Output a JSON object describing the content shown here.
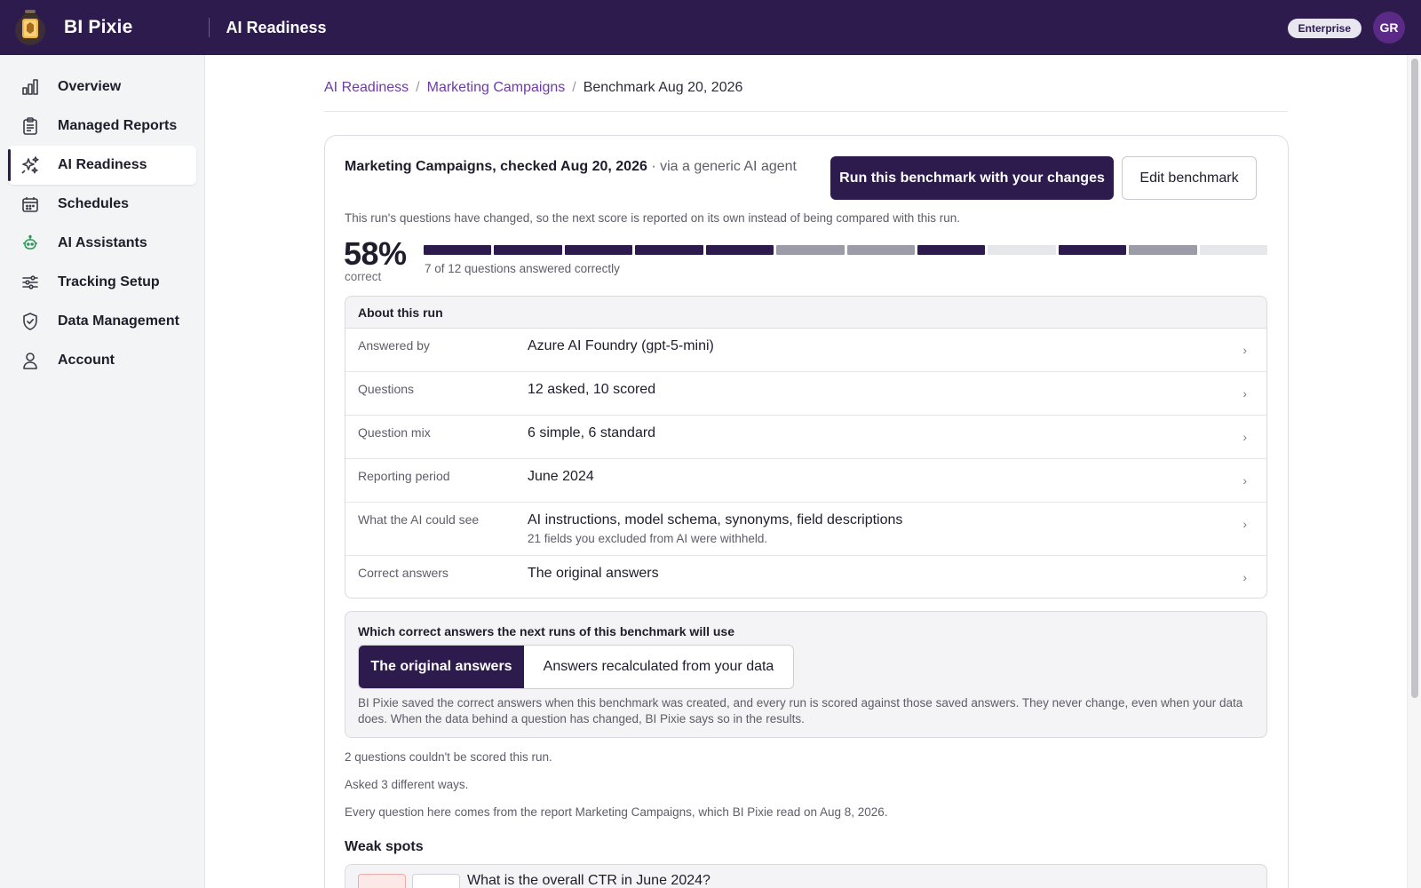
{
  "header": {
    "brand": "BI Pixie",
    "page_title": "AI Readiness",
    "plan_badge": "Enterprise",
    "avatar_initials": "GR",
    "logo_icon": "lantern-icon"
  },
  "sidebar": {
    "items": [
      {
        "label": "Overview",
        "icon": "bar-chart-icon",
        "active": false
      },
      {
        "label": "Managed Reports",
        "icon": "reports-icon",
        "active": false
      },
      {
        "label": "AI Readiness",
        "icon": "sparkles-icon",
        "active": true
      },
      {
        "label": "Schedules",
        "icon": "calendar-icon",
        "active": false
      },
      {
        "label": "AI Assistants",
        "icon": "robot-icon",
        "active": false
      },
      {
        "label": "Tracking Setup",
        "icon": "sliders-icon",
        "active": false
      },
      {
        "label": "Data Management",
        "icon": "shield-check-icon",
        "active": false
      },
      {
        "label": "Account",
        "icon": "user-icon",
        "active": false
      }
    ]
  },
  "breadcrumb": {
    "items": [
      "AI Readiness",
      "Marketing Campaigns"
    ],
    "current": "Benchmark Aug 20, 2026",
    "separator": "/"
  },
  "run": {
    "title": "Marketing Campaigns, checked Aug 20, 2026",
    "via": "· via a generic AI agent",
    "primary_action": "Run this benchmark with your changes",
    "secondary_action": "Edit benchmark",
    "change_note": "This run's questions have changed, so the next score is reported on its own instead of being compared with this run.",
    "score": "58%",
    "score_label": "correct",
    "results_caption": "7 of 12 questions answered correctly",
    "question_results": [
      "correct",
      "correct",
      "correct",
      "correct",
      "correct",
      "wrong",
      "wrong",
      "correct",
      "unscored",
      "correct",
      "wrong",
      "unscored"
    ]
  },
  "about": {
    "title": "About this run",
    "rows": [
      {
        "label": "Answered by",
        "value": "Azure AI Foundry (gpt-5-mini)"
      },
      {
        "label": "Questions",
        "value": "12 asked, 10 scored"
      },
      {
        "label": "Question mix",
        "value": "6 simple, 6 standard"
      },
      {
        "label": "Reporting period",
        "value": "June 2024"
      },
      {
        "label": "What the AI could see",
        "value": "AI instructions, model schema, synonyms, field descriptions",
        "detail": "21 fields you excluded from AI were withheld."
      },
      {
        "label": "Correct answers",
        "value": "The original answers"
      }
    ],
    "chevron": "›"
  },
  "answers": {
    "title": "Which correct answers the next runs of this benchmark will use",
    "options": [
      "The original answers",
      "Answers recalculated from your data"
    ],
    "selected": "The original answers",
    "description": "BI Pixie saved the correct answers when this benchmark was created, and every run is scored against those saved answers. They never change, even when your data does. When the data behind a question has changed, BI Pixie says so in the results."
  },
  "notes": {
    "unscored": "2 questions couldn't be scored this run.",
    "asked": "Asked 3 different ways.",
    "source": "Every question here comes from the report Marketing Campaigns, which BI Pixie read on Aug 8, 2026."
  },
  "weak_spots": {
    "title": "Weak spots",
    "first_question": "What is the overall CTR in June 2024?"
  },
  "colors": {
    "brand_dark": "#2d1b4e",
    "link": "#6d3aa8",
    "correct": "#2d1b4e",
    "wrong": "#9b9ca8",
    "unscored": "#e6e7eb"
  }
}
